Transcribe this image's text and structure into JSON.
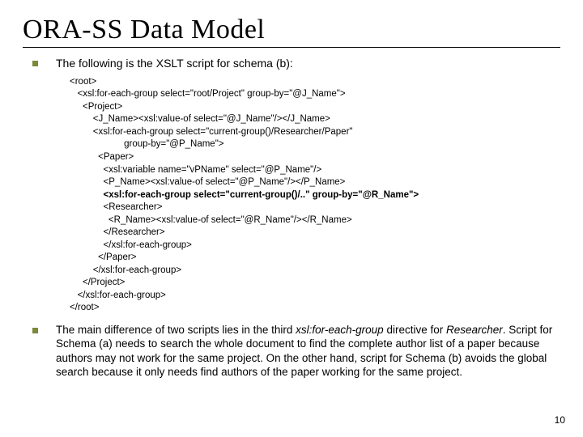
{
  "title": "ORA-SS Data Model",
  "intro": "The following is the XSLT script for schema (b):",
  "code": {
    "l1": "<root>",
    "l2": "   <xsl:for-each-group select=\"root/Project\" group-by=\"@J_Name\">",
    "l3": "     <Project>",
    "l4": "         <J_Name><xsl:value-of select=\"@J_Name\"/></J_Name>",
    "l5": "         <xsl:for-each-group select=\"current-group()/Researcher/Paper\"",
    "l6": "                     group-by=\"@P_Name\">",
    "l7": "           <Paper>",
    "l8": "             <xsl:variable name=\"vPName\" select=\"@P_Name\"/>",
    "l9": "             <P_Name><xsl:value-of select=\"@P_Name\"/></P_Name>",
    "l10b": "             <xsl:for-each-group select=\"current-group()/..\" group-by=\"@R_Name\">",
    "l11": "             <Researcher>",
    "l12": "               <R_Name><xsl:value-of select=\"@R_Name\"/></R_Name>",
    "l13": "             </Researcher>",
    "l14": "             </xsl:for-each-group>",
    "l15": "           </Paper>",
    "l16": "         </xsl:for-each-group>",
    "l17": "     </Project>",
    "l18": "   </xsl:for-each-group>",
    "l19": "</root>"
  },
  "footer_pre": "The main difference of two scripts lies in the third ",
  "footer_ital1": "xsl:for-each-group",
  "footer_mid1": " directive for ",
  "footer_ital2": "Researcher",
  "footer_post": ". Script for Schema (a) needs to search the whole document to find the complete author list of a paper because authors may not work for the same project. On the other hand, script for Schema (b) avoids the global search because it only needs find authors of the paper working for the same project.",
  "page_number": "10"
}
